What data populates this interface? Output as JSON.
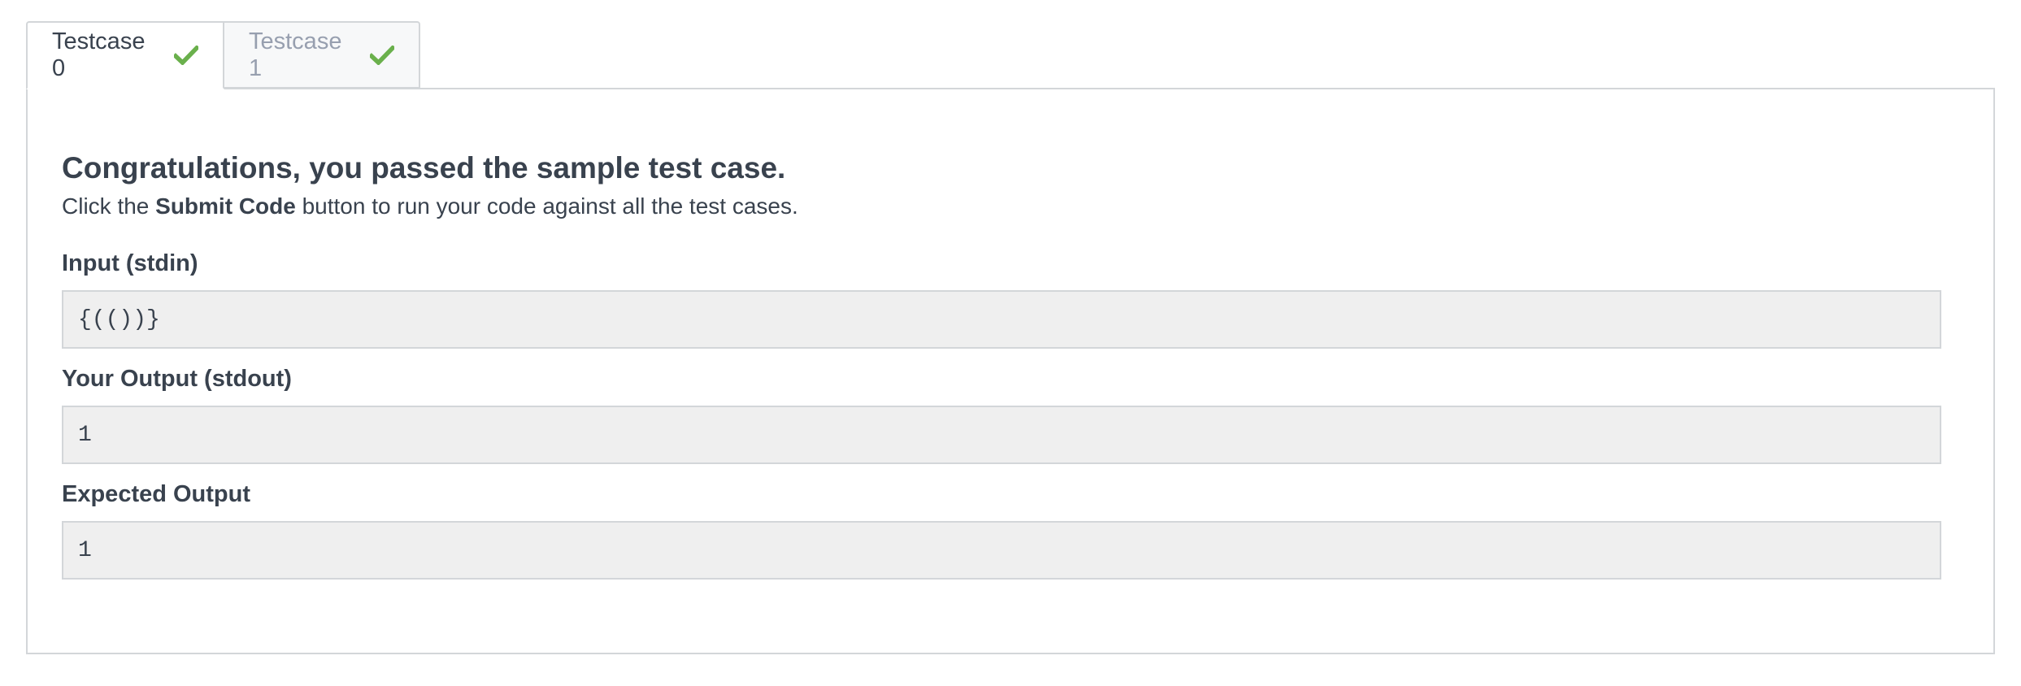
{
  "tabs": [
    {
      "label": "Testcase 0",
      "status": "passed",
      "active": true
    },
    {
      "label": "Testcase 1",
      "status": "passed",
      "active": false
    }
  ],
  "colors": {
    "check": "#6ab04c",
    "inactive_tab_text": "#979faf",
    "text": "#39424e",
    "code_bg": "#efefef",
    "border": "#d3d6d9"
  },
  "result": {
    "heading": "Congratulations, you passed the sample test case.",
    "subtext_before": "Click the ",
    "subtext_bold": "Submit Code",
    "subtext_after": " button to run your code against all the test cases."
  },
  "sections": {
    "input": {
      "label": "Input (stdin)",
      "value": "{(())}"
    },
    "output": {
      "label": "Your Output (stdout)",
      "value": "1"
    },
    "expected": {
      "label": "Expected Output",
      "value": "1"
    }
  }
}
